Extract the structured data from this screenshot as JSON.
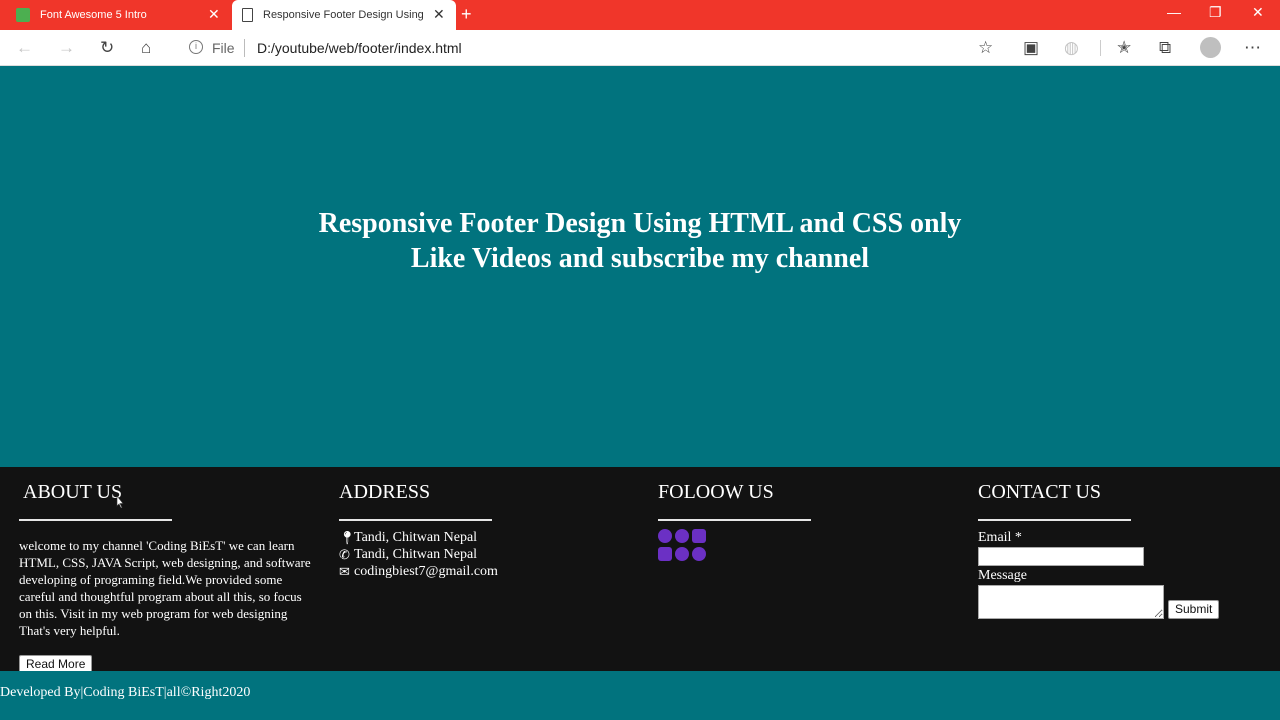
{
  "browser": {
    "tabs": [
      {
        "title": "Font Awesome 5 Intro",
        "active": false
      },
      {
        "title": "Responsive Footer Design Using",
        "active": true
      }
    ],
    "address": {
      "scheme_label": "File",
      "url": "D:/youtube/web/footer/index.html"
    },
    "colors": {
      "tab_bar": "#f0362a"
    }
  },
  "hero": {
    "line1": "Responsive Footer Design Using HTML and CSS only",
    "line2": "Like Videos and subscribe my channel",
    "bg_color": "#01737e"
  },
  "footer": {
    "about": {
      "heading": "ABOUT US",
      "text": "welcome to my channel 'Coding BiEsT' we can learn HTML, CSS, JAVA Script, web designing, and software developing of programing field.We provided some careful and thoughtful program about all this, so focus on this. Visit in my web program for web designing That's very helpful.",
      "button": "Read More"
    },
    "address": {
      "heading": "ADDRESS",
      "location": "Tandi, Chitwan Nepal",
      "phone": "Tandi, Chitwan Nepal",
      "email": "codingbiest7@gmail.com"
    },
    "follow": {
      "heading": "FOLOOW US",
      "icons": [
        "facebook-icon",
        "twitter-icon",
        "instagram-icon",
        "youtube-icon",
        "snapchat-icon",
        "twitter-icon"
      ],
      "icon_color": "#6b30c4"
    },
    "contact": {
      "heading": "CONTACT US",
      "email_label": "Email *",
      "message_label": "Message",
      "submit": "Submit"
    }
  },
  "bottom_bar": {
    "text": "Developed By|Coding BiEsT|all©Right2020"
  }
}
